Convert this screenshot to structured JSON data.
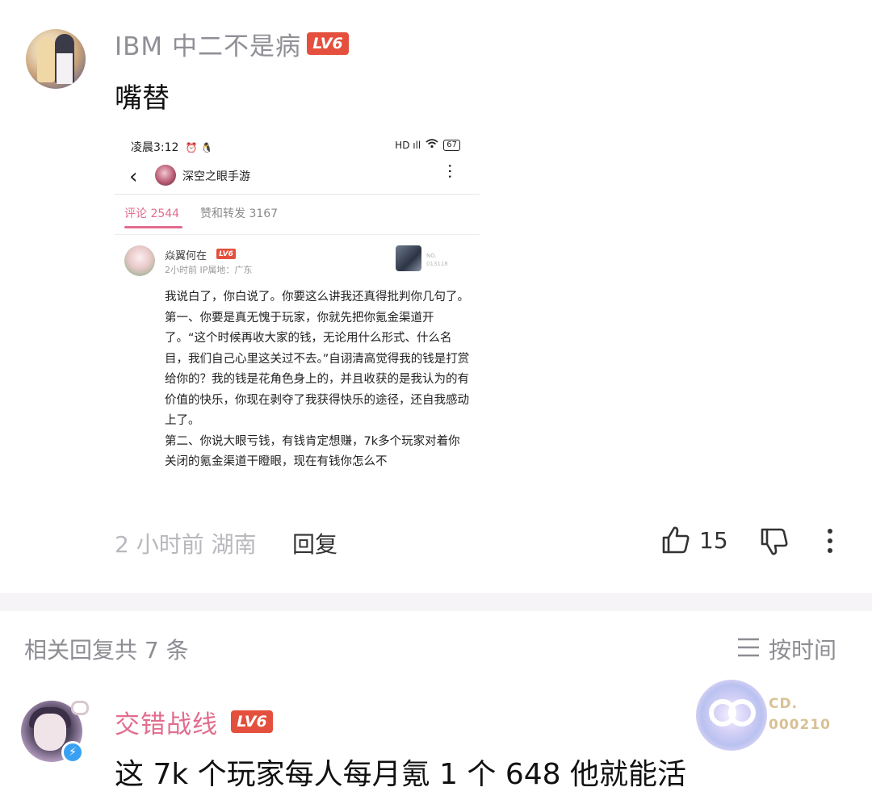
{
  "comment": {
    "username": "IBM 中二不是病",
    "level": "LV6",
    "text": "嘴替",
    "time_location": "2 小时前 湖南",
    "reply_label": "回复",
    "like_count": "15"
  },
  "embedded_screenshot": {
    "status_time": "凌晨3:12",
    "status_icons": "⏰ 🐧",
    "signal": "HD ıll",
    "battery": "67",
    "title": "深空之眼手游",
    "tab_comments": "评论 2544",
    "tab_likes": "赞和转发 3167",
    "comment_user": "焱翼何在",
    "comment_level": "LV6",
    "comment_meta": "2小时前  IP属地：广东",
    "deco_text_line1": "NO.",
    "deco_text_line2": "013118",
    "paragraphs": [
      "我说白了，你白说了。你要这么讲我还真得批判你几句了。",
      "第一、你要是真无愧于玩家，你就先把你氪金渠道开了。“这个时候再收大家的钱，无论用什么形式、什么名目，我们自己心里这关过不去。”自诩清高觉得我的钱是打赏给你的？我的钱是花角色身上的，并且收获的是我认为的有价值的快乐，你现在剥夺了我获得快乐的途径，还自我感动上了。",
      "第二、你说大眼亏钱，有钱肯定想赚，7k多个玩家对着你关闭的氪金渠道干瞪眼，现在有钱你怎么不"
    ]
  },
  "replies": {
    "count_label": "相关回复共 7 条",
    "sort_label": "按时间"
  },
  "reply": {
    "username": "交错战线",
    "level": "LV6",
    "text": "这 7k 个玩家每人每月氪 1 个 648 他就能活",
    "fan_badge_line1": "CD.",
    "fan_badge_line2": "000210"
  },
  "colors": {
    "accent_pink": "#e26c8e",
    "level_red": "#e4503d",
    "muted_gray": "#8d8d93",
    "verify_blue": "#3aa1f2"
  },
  "icons": [
    "thumbs-up-icon",
    "thumbs-down-icon",
    "more-vertical-icon",
    "sort-lines-icon",
    "back-arrow-icon",
    "verified-badge-icon"
  ]
}
